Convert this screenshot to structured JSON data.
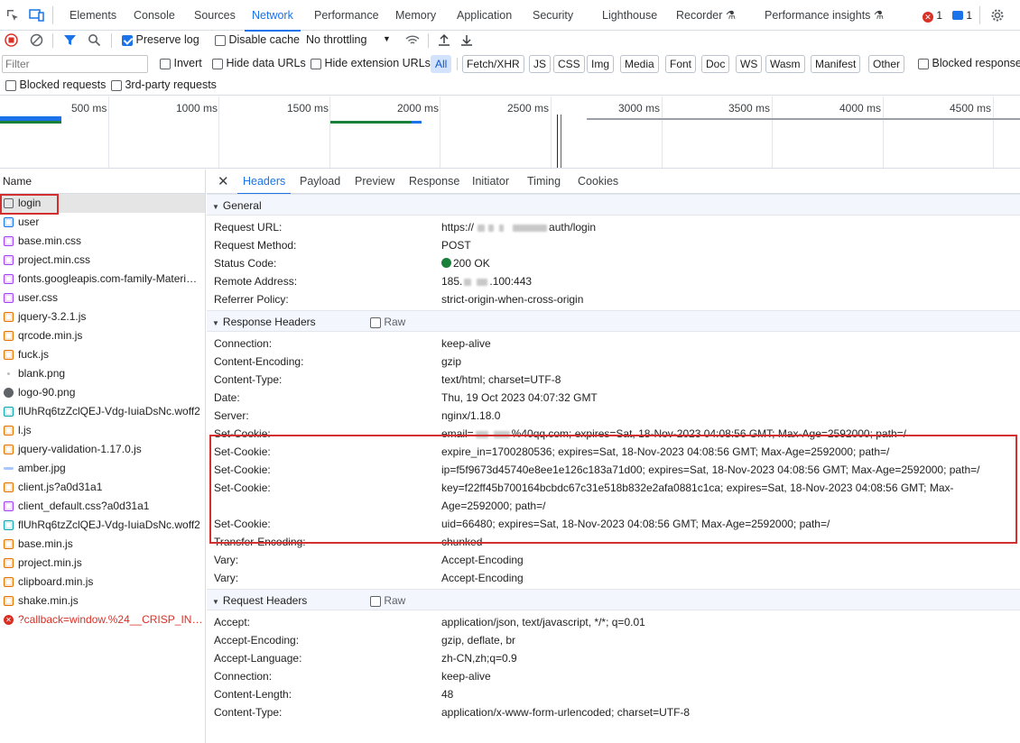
{
  "top_tabs": [
    "Elements",
    "Console",
    "Sources",
    "Network",
    "Performance",
    "Memory",
    "Application",
    "Security",
    "Lighthouse",
    "Recorder",
    "Performance insights"
  ],
  "active_tab": "Network",
  "badges": {
    "errors": "1",
    "messages": "1"
  },
  "toolbar": {
    "preserve_log": "Preserve log",
    "disable_cache": "Disable cache",
    "throttling": "No throttling"
  },
  "filter": {
    "placeholder": "Filter",
    "invert": "Invert",
    "hide_data_urls": "Hide data URLs",
    "hide_ext_urls": "Hide extension URLs",
    "blocked_response": "Blocked response"
  },
  "type_chips": [
    "All",
    "Fetch/XHR",
    "JS",
    "CSS",
    "Img",
    "Media",
    "Font",
    "Doc",
    "WS",
    "Wasm",
    "Manifest",
    "Other"
  ],
  "blocked_requests": "Blocked requests",
  "third_party": "3rd-party requests",
  "timeline_ticks": [
    "500 ms",
    "1000 ms",
    "1500 ms",
    "2000 ms",
    "2500 ms",
    "3000 ms",
    "3500 ms",
    "4000 ms",
    "4500 ms"
  ],
  "list": {
    "header": "Name",
    "items": [
      {
        "name": "login",
        "type": "doc"
      },
      {
        "name": "user",
        "type": "xhr"
      },
      {
        "name": "base.min.css",
        "type": "css"
      },
      {
        "name": "project.min.css",
        "type": "css"
      },
      {
        "name": "fonts.googleapis.com-family-Materi…",
        "type": "css"
      },
      {
        "name": "user.css",
        "type": "css"
      },
      {
        "name": "jquery-3.2.1.js",
        "type": "js"
      },
      {
        "name": "qrcode.min.js",
        "type": "js"
      },
      {
        "name": "fuck.js",
        "type": "js"
      },
      {
        "name": "blank.png",
        "type": "blank"
      },
      {
        "name": "logo-90.png",
        "type": "img"
      },
      {
        "name": "flUhRq6tzZclQEJ-Vdg-IuiaDsNc.woff2",
        "type": "font"
      },
      {
        "name": "l.js",
        "type": "js"
      },
      {
        "name": "jquery-validation-1.17.0.js",
        "type": "js"
      },
      {
        "name": "amber.jpg",
        "type": "jpg"
      },
      {
        "name": "client.js?a0d31a1",
        "type": "js"
      },
      {
        "name": "client_default.css?a0d31a1",
        "type": "css"
      },
      {
        "name": "flUhRq6tzZclQEJ-Vdg-IuiaDsNc.woff2",
        "type": "font"
      },
      {
        "name": "base.min.js",
        "type": "js"
      },
      {
        "name": "project.min.js",
        "type": "js"
      },
      {
        "name": "clipboard.min.js",
        "type": "js"
      },
      {
        "name": "shake.min.js",
        "type": "js"
      },
      {
        "name": "?callback=window.%24__CRISP_INST…",
        "type": "error"
      }
    ]
  },
  "detail_tabs": [
    "Headers",
    "Payload",
    "Preview",
    "Response",
    "Initiator",
    "Timing",
    "Cookies"
  ],
  "general": {
    "title": "General",
    "rows": [
      {
        "k": "Request URL:",
        "v": "https://",
        "v2": "auth/login"
      },
      {
        "k": "Request Method:",
        "v": "POST"
      },
      {
        "k": "Status Code:",
        "v": "200 OK"
      },
      {
        "k": "Remote Address:",
        "v": "185.",
        "v2": ".100:443"
      },
      {
        "k": "Referrer Policy:",
        "v": "strict-origin-when-cross-origin"
      }
    ]
  },
  "response_headers": {
    "title": "Response Headers",
    "raw": "Raw",
    "rows": [
      {
        "k": "Connection:",
        "v": "keep-alive"
      },
      {
        "k": "Content-Encoding:",
        "v": "gzip"
      },
      {
        "k": "Content-Type:",
        "v": "text/html; charset=UTF-8"
      },
      {
        "k": "Date:",
        "v": "Thu, 19 Oct 2023 04:07:32 GMT"
      },
      {
        "k": "Server:",
        "v": "nginx/1.18.0"
      },
      {
        "k": "Set-Cookie:",
        "v": "email=",
        "v2": "%40qq.com; expires=Sat, 18-Nov-2023 04:08:56 GMT; Max-Age=2592000; path=/"
      },
      {
        "k": "Set-Cookie:",
        "v": "expire_in=1700280536; expires=Sat, 18-Nov-2023 04:08:56 GMT; Max-Age=2592000; path=/"
      },
      {
        "k": "Set-Cookie:",
        "v": "ip=f5f9673d45740e8ee1e126c183a71d00; expires=Sat, 18-Nov-2023 04:08:56 GMT; Max-Age=2592000; path=/"
      },
      {
        "k": "Set-Cookie:",
        "v": "key=f22ff45b700164bcbdc67c31e518b832e2afa0881c1ca; expires=Sat, 18-Nov-2023 04:08:56 GMT; Max-Age=2592000; path=/"
      },
      {
        "k": "Set-Cookie:",
        "v": "uid=66480; expires=Sat, 18-Nov-2023 04:08:56 GMT; Max-Age=2592000; path=/"
      },
      {
        "k": "Transfer-Encoding:",
        "v": "chunked"
      },
      {
        "k": "Vary:",
        "v": "Accept-Encoding"
      },
      {
        "k": "Vary:",
        "v": "Accept-Encoding"
      }
    ]
  },
  "request_headers": {
    "title": "Request Headers",
    "raw": "Raw",
    "rows": [
      {
        "k": "Accept:",
        "v": "application/json, text/javascript, */*; q=0.01"
      },
      {
        "k": "Accept-Encoding:",
        "v": "gzip, deflate, br"
      },
      {
        "k": "Accept-Language:",
        "v": "zh-CN,zh;q=0.9"
      },
      {
        "k": "Connection:",
        "v": "keep-alive"
      },
      {
        "k": "Content-Length:",
        "v": "48"
      },
      {
        "k": "Content-Type:",
        "v": "application/x-www-form-urlencoded; charset=UTF-8"
      }
    ]
  },
  "colors": {
    "accent": "#1a73e8",
    "highlight": "#d32f2f",
    "success": "#188038"
  }
}
